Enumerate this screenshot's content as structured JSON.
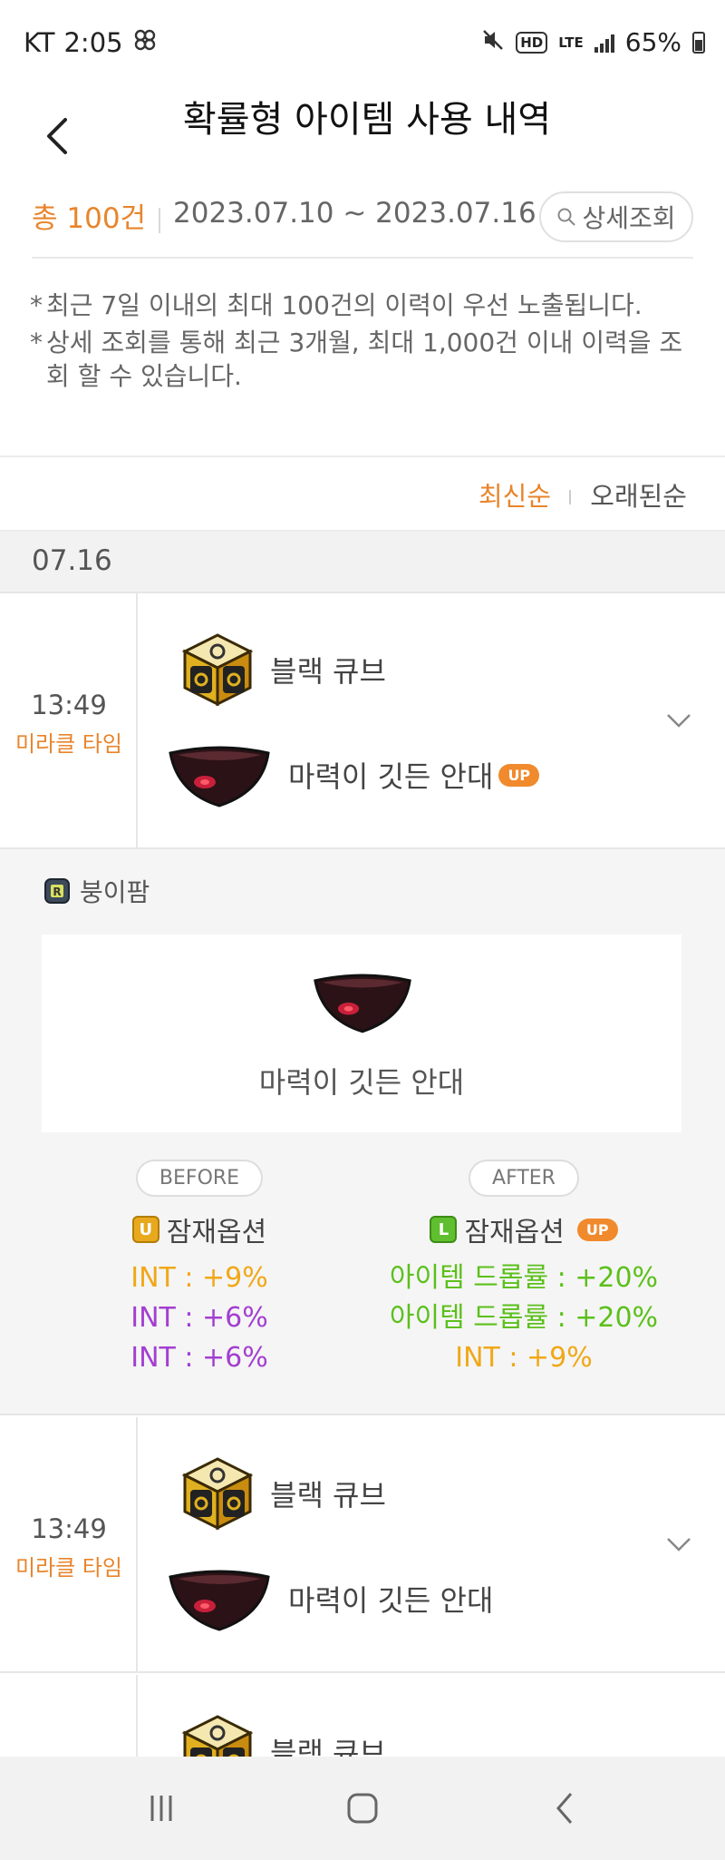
{
  "status_bar": {
    "carrier": "KT",
    "time": "2:05",
    "battery": "65%",
    "network": "LTE",
    "hd": "HD"
  },
  "header": {
    "title": "확률형 아이템 사용 내역"
  },
  "summary": {
    "total": "총 100건",
    "date_range": "2023.07.10 ~ 2023.07.16",
    "detail_button": "상세조회"
  },
  "notes": [
    "최근 7일 이내의 최대 100건의 이력이 우선 노출됩니다.",
    "상세 조회를 통해 최근 3개월, 최대 1,000건 이내 이력을 조회 할 수 있습니다."
  ],
  "sort": {
    "newest": "최신순",
    "oldest": "오래된순"
  },
  "date_group": "07.16",
  "entries": [
    {
      "time": "13:49",
      "event": "미라클 타임",
      "cube_name": "블랙 큐브",
      "item_name": "마력이 깃든 안대",
      "badge": "UP"
    },
    {
      "time": "13:49",
      "event": "미라클 타임",
      "cube_name": "블랙 큐브",
      "item_name": "마력이 깃든 안대"
    },
    {
      "cube_name": "블랙 큐브"
    }
  ],
  "detail": {
    "character": "붕이팜",
    "item_name": "마력이 깃든 안대",
    "before": {
      "label": "BEFORE",
      "grade_letter": "U",
      "grade_label": "잠재옵션",
      "options": [
        "INT : +9%",
        "INT : +6%",
        "INT : +6%"
      ]
    },
    "after": {
      "label": "AFTER",
      "grade_letter": "L",
      "grade_label": "잠재옵션",
      "badge": "UP",
      "options": [
        "아이템 드롭률 : +20%",
        "아이템 드롭률 : +20%",
        "INT : +9%"
      ]
    }
  },
  "colors": {
    "accent_orange": "#e8852c",
    "unique_gold": "#f0a818",
    "epic_purple": "#a33fd0",
    "legendary_green": "#5cc01c"
  },
  "icons": {
    "cube": "black-cube-icon",
    "item": "eyepatch-item-icon",
    "search": "search-icon",
    "back": "back-arrow-icon",
    "expand": "chevron-down-icon"
  }
}
